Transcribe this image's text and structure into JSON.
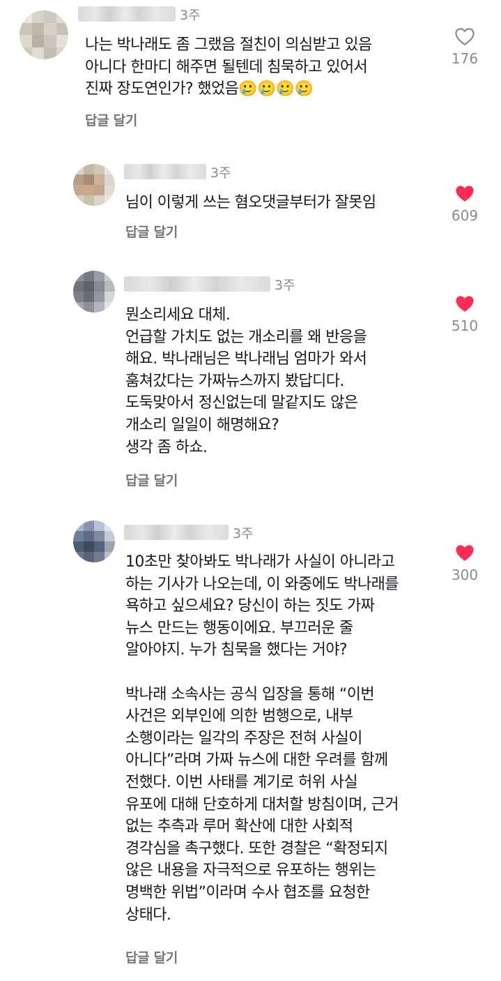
{
  "comments": [
    {
      "time": "3주",
      "text": "나는 박나래도 좀 그랬음 절친이 의심받고 있음\n아니다 한마디 해주면 될텐데 침묵하고 있어서\n진짜 장도연인가? 했었음🥲🥲🥲🥲",
      "reply_label": "답글 달기",
      "likes": "176",
      "liked": false
    },
    {
      "time": "3주",
      "text": "님이 이렇게 쓰는 혐오댓글부터가 잘못임",
      "reply_label": "답글 달기",
      "likes": "609",
      "liked": true
    },
    {
      "time": "3주",
      "text": "뭔소리세요 대체.\n언급할 가치도 없는 개소리를 왜 반응을\n해요. 박나래님은 박나래님 엄마가 와서\n훔쳐갔다는 가짜뉴스까지 봤답디다.\n도둑맞아서 정신없는데 말같지도 않은\n개소리 일일이 해명해요?\n생각 좀 하쇼.",
      "reply_label": "답글 달기",
      "likes": "510",
      "liked": true
    },
    {
      "time": "3주",
      "text": "10초만 찾아봐도 박나래가 사실이 아니라고\n하는 기사가 나오는데, 이 와중에도 박나래를\n욕하고 싶으세요? 당신이 하는 짓도 가짜\n뉴스 만드는 행동이에요. 부끄러운 줄\n알아야지. 누가 침묵을 했다는 거야?\n\n박나래 소속사는 공식 입장을 통해 “이번\n사건은 외부인에 의한 범행으로, 내부\n소행이라는 일각의 주장은 전혀 사실이\n아니다”라며 가짜 뉴스에 대한 우려를 함께\n전했다. 이번 사태를 계기로 허위 사실\n유포에 대해 단호하게 대처할 방침이며, 근거\n없는 추측과 루머 확산에 대한 사회적\n경각심을 촉구했다. 또한 경찰은 “확정되지\n않은 내용을 자극적으로 유포하는 행위는\n명백한 위법”이라며 수사 협조를 요청한\n상태다.",
      "reply_label": "답글 달기",
      "likes": "300",
      "liked": true
    }
  ],
  "colors": {
    "heart_filled": "#fe2c55",
    "heart_outline": "#8a8b91",
    "reply_text": "#75767b",
    "meta_text": "#8a8b91",
    "body_text": "#161823"
  },
  "icons": {
    "like_filled": "heart-filled-icon",
    "like_outline": "heart-outline-icon"
  }
}
